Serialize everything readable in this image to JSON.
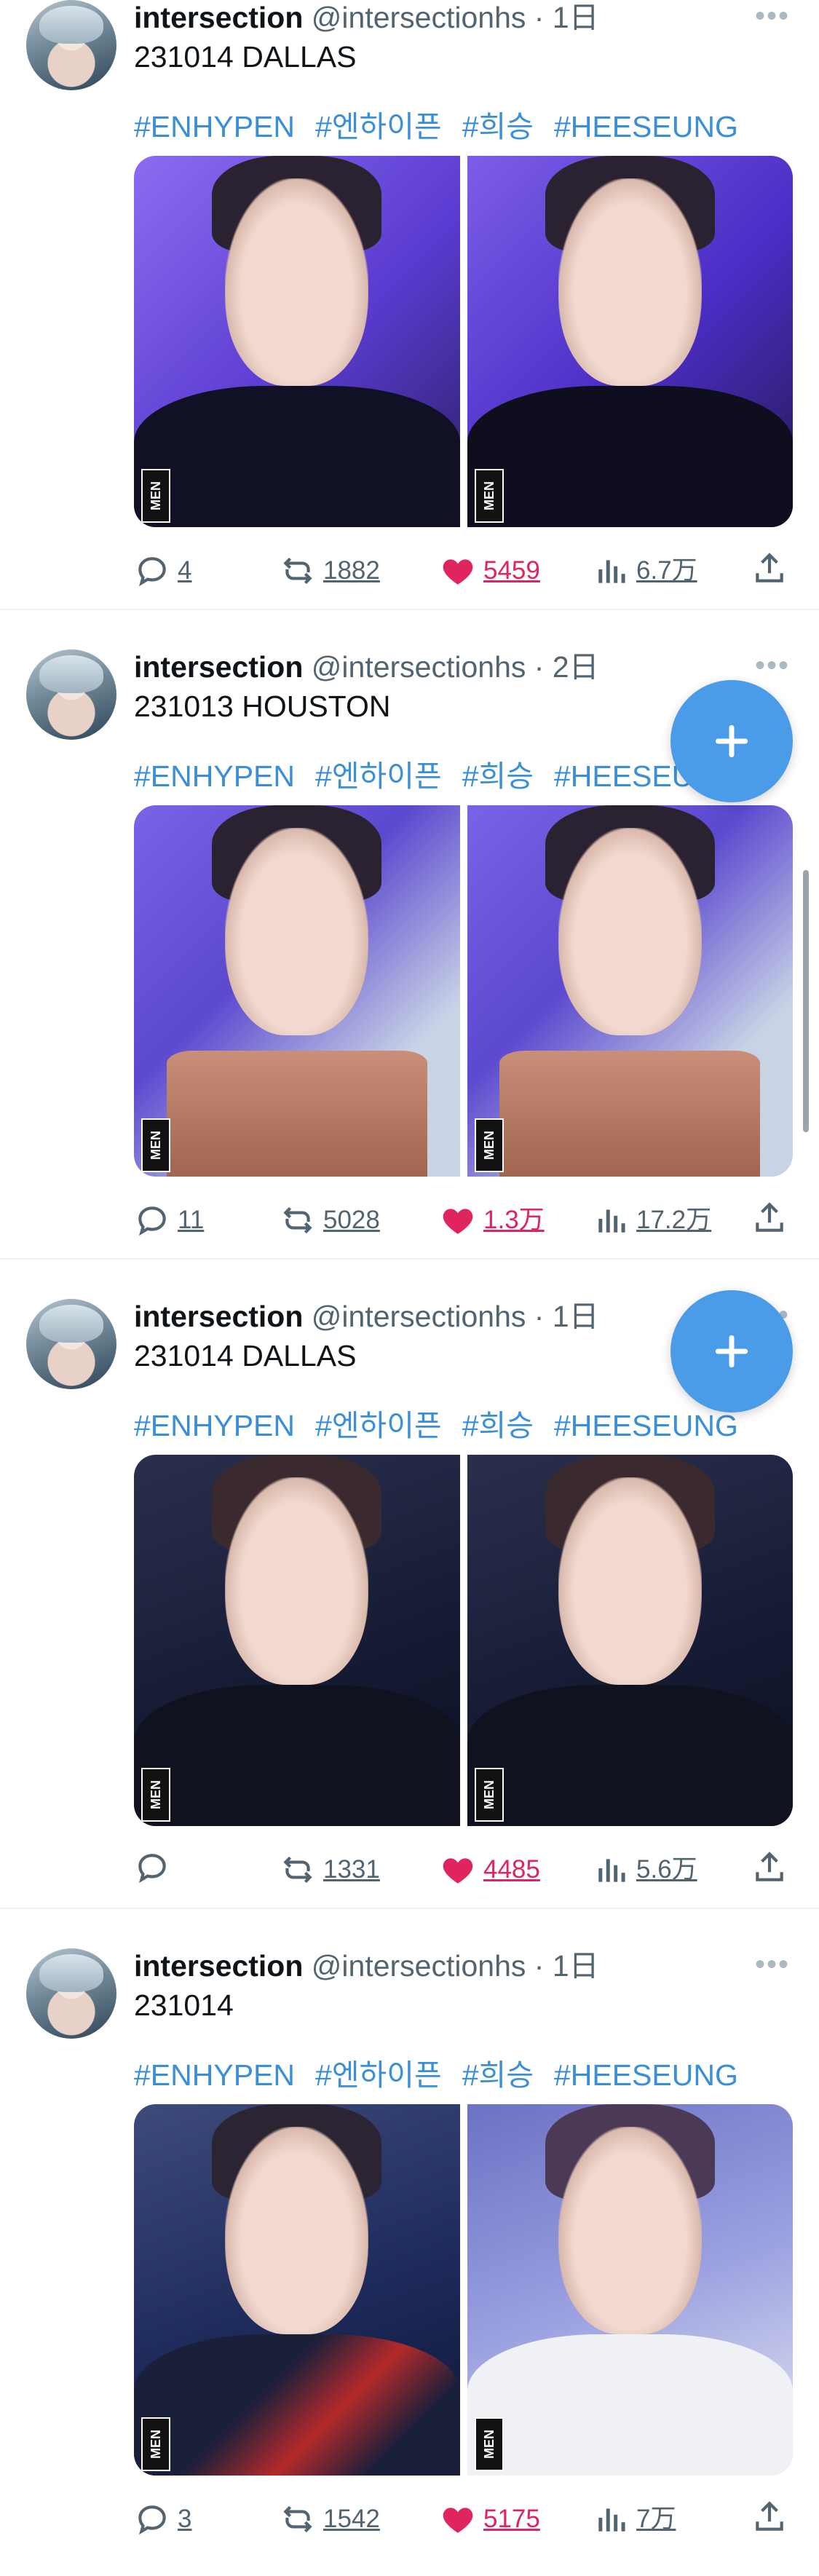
{
  "colors": {
    "accent": "#4a9ce8",
    "like": "#e0245e",
    "hashtag": "#3a8fd6",
    "muted": "#536471"
  },
  "tweets": [
    {
      "name": "intersection",
      "handle": "@intersectionhs",
      "time": "· 1日",
      "text": "231014 DALLAS",
      "hashtags": [
        "#ENHYPEN",
        "#엔하이픈",
        "#희승",
        "#HEESEUNG"
      ],
      "replies": "4",
      "retweets": "1882",
      "likes": "5459",
      "views": "6.7万",
      "media": [
        "stage-photo-purple-1",
        "stage-photo-purple-2"
      ]
    },
    {
      "name": "intersection",
      "handle": "@intersectionhs",
      "time": "· 2日",
      "text": "231013 HOUSTON",
      "hashtags": [
        "#ENHYPEN",
        "#엔하이픈",
        "#희승",
        "#HEESEUNG"
      ],
      "replies": "11",
      "retweets": "5028",
      "likes": "1.3万",
      "views": "17.2万",
      "media": [
        "birthday-cake-photo-1",
        "birthday-cake-photo-2"
      ]
    },
    {
      "name": "intersection",
      "handle": "@intersectionhs",
      "time": "· 1日",
      "text": "231014 DALLAS",
      "hashtags": [
        "#ENHYPEN",
        "#엔하이픈",
        "#희승",
        "#HEESEUNG"
      ],
      "replies": "",
      "retweets": "1331",
      "likes": "4485",
      "views": "5.6万",
      "media": [
        "stage-photo-navy-1",
        "stage-photo-navy-2"
      ]
    },
    {
      "name": "intersection",
      "handle": "@intersectionhs",
      "time": "· 1日",
      "text": "231014",
      "hashtags": [
        "#ENHYPEN",
        "#엔하이픈",
        "#희승",
        "#HEESEUNG"
      ],
      "replies": "3",
      "retweets": "1542",
      "likes": "5175",
      "views": "7万",
      "media": [
        "stage-photo-red-1",
        "stage-photo-white-2"
      ]
    }
  ],
  "watermark": "MEN",
  "fab_icon": "plus-icon"
}
